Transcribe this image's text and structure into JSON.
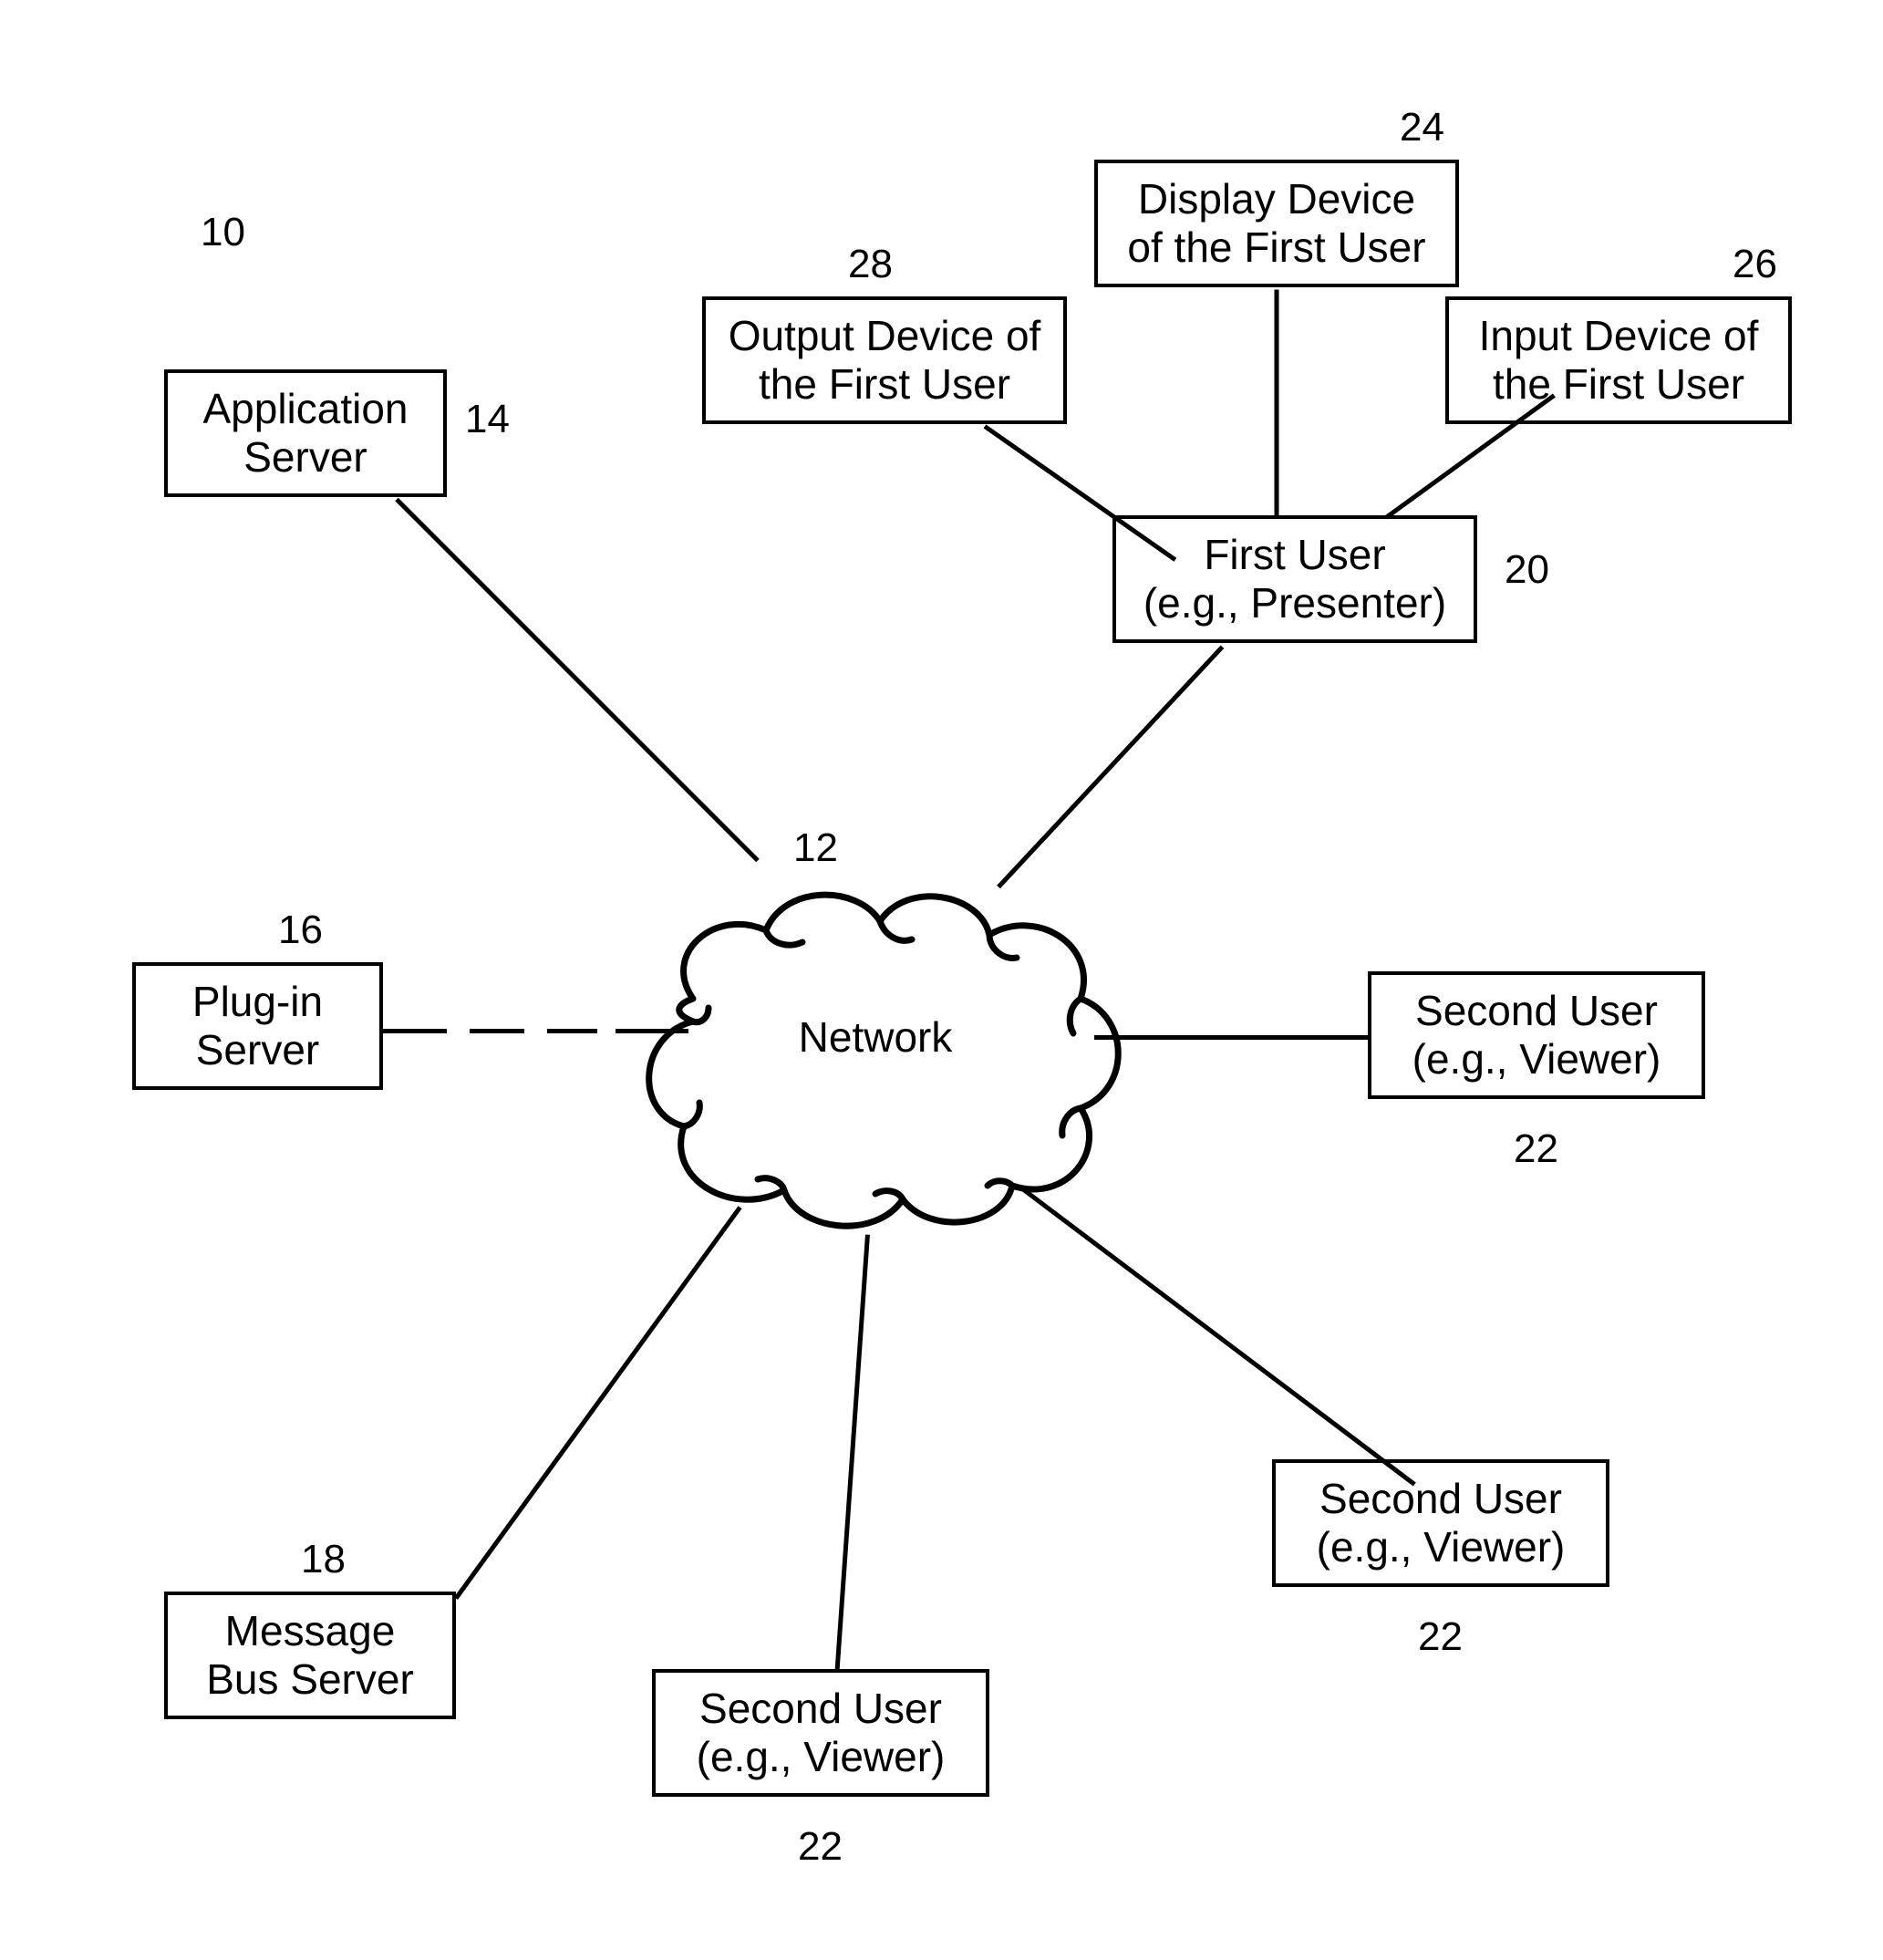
{
  "refs": {
    "system": "10",
    "network": "12",
    "app_server": "14",
    "plugin_server": "16",
    "msg_bus_server": "18",
    "first_user": "20",
    "second_user_a": "22",
    "second_user_b": "22",
    "second_user_c": "22",
    "display_device": "24",
    "input_device": "26",
    "output_device": "28"
  },
  "labels": {
    "network": "Network",
    "app_server_l1": "Application",
    "app_server_l2": "Server",
    "plugin_server_l1": "Plug-in",
    "plugin_server_l2": "Server",
    "msg_bus_l1": "Message",
    "msg_bus_l2": "Bus Server",
    "first_user_l1": "First User",
    "first_user_l2": "(e.g., Presenter)",
    "second_user_l1": "Second User",
    "second_user_l2": "(e.g., Viewer)",
    "display_l1": "Display Device",
    "display_l2": "of the First User",
    "output_l1": "Output Device of",
    "output_l2": "the First User",
    "input_l1": "Input Device of",
    "input_l2": "the First User"
  }
}
